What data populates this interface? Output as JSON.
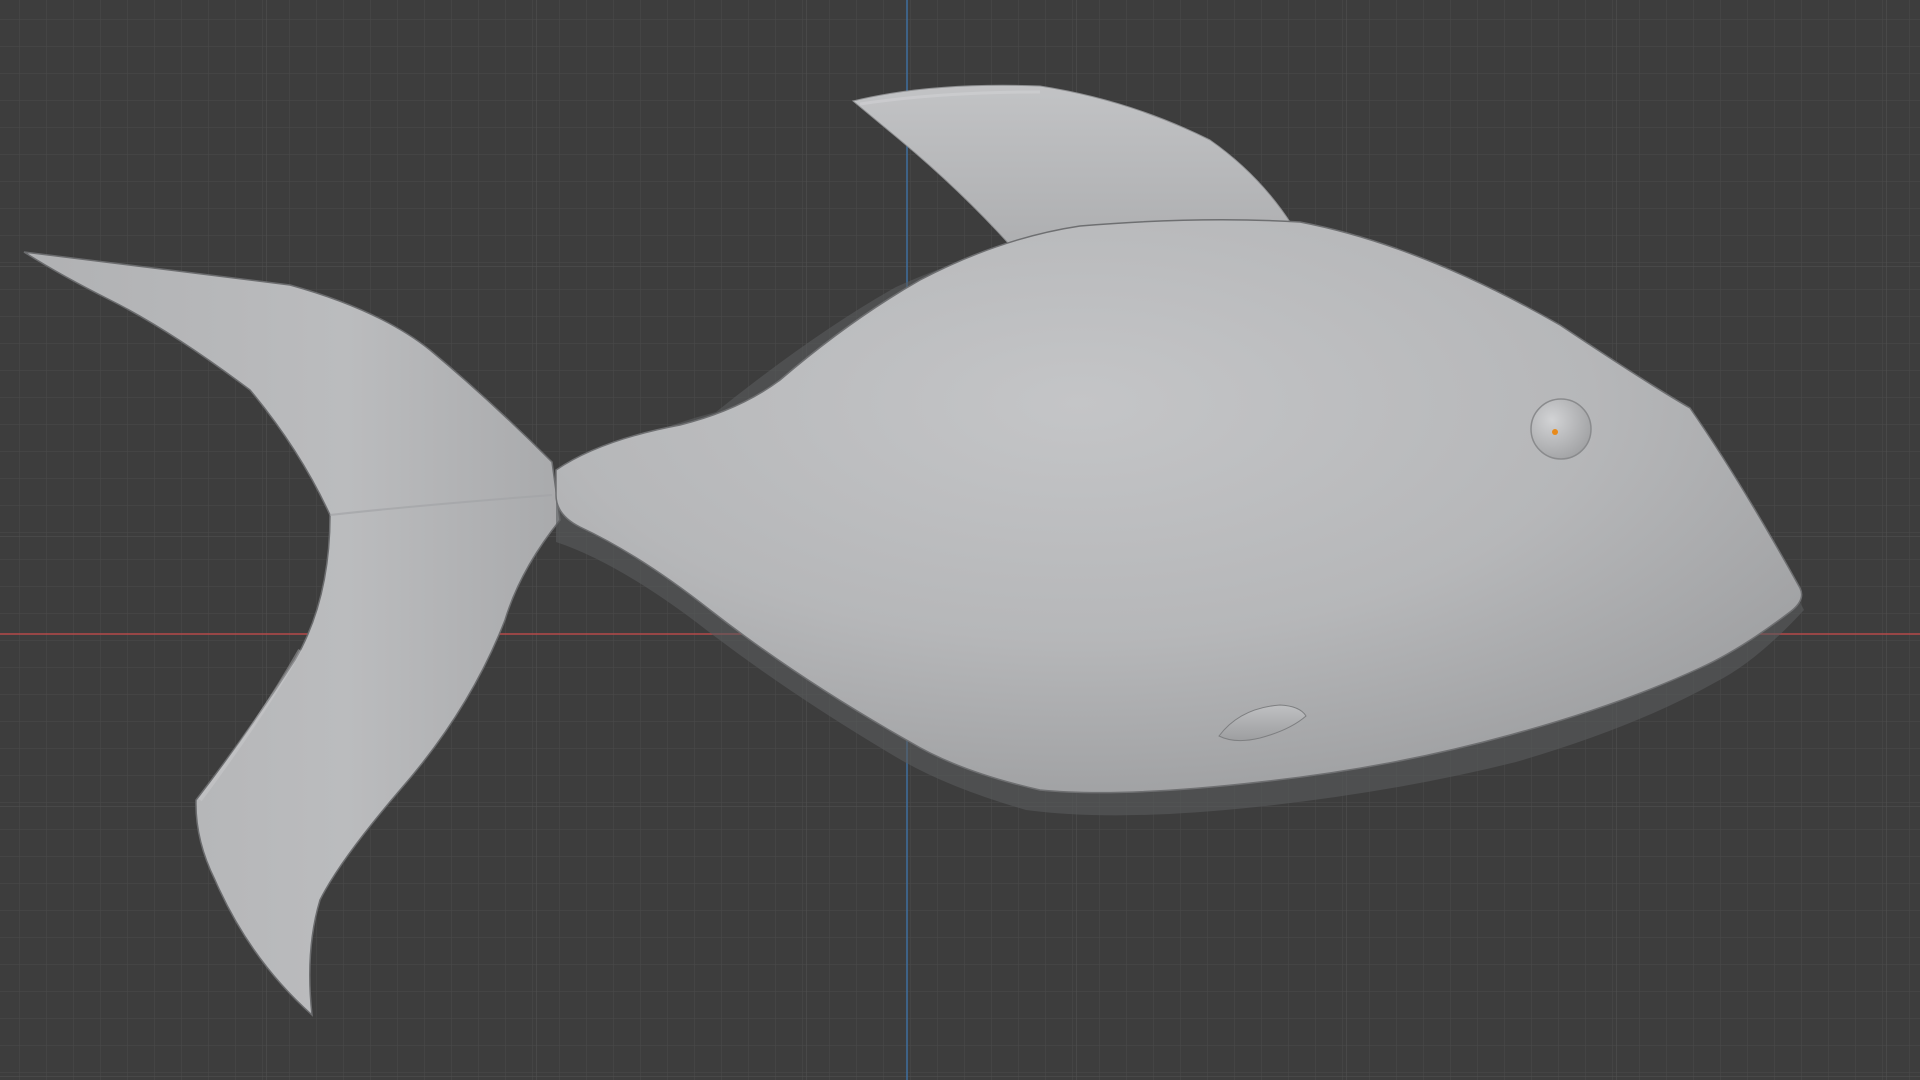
{
  "viewport": {
    "background_color": "#3d3d3d",
    "grid": {
      "visible": true,
      "line_color": "#4c4c4c",
      "major_line_color": "#535353"
    },
    "axes": {
      "x_axis": {
        "color": "#b54a4a",
        "visible": true
      },
      "z_axis": {
        "color": "#3f6f9f",
        "visible": true
      }
    }
  },
  "scene": {
    "objects": [
      {
        "name": "fish-body",
        "color": "#b8b9bb"
      },
      {
        "name": "dorsal-fin",
        "color": "#b3b4b6"
      },
      {
        "name": "tail-fin",
        "color": "#b5b6b8"
      },
      {
        "name": "pectoral-fin",
        "color": "#a8a9ab"
      },
      {
        "name": "eye",
        "color": "#b7b8ba"
      }
    ],
    "origin_point": {
      "color": "#e88a1a"
    }
  }
}
